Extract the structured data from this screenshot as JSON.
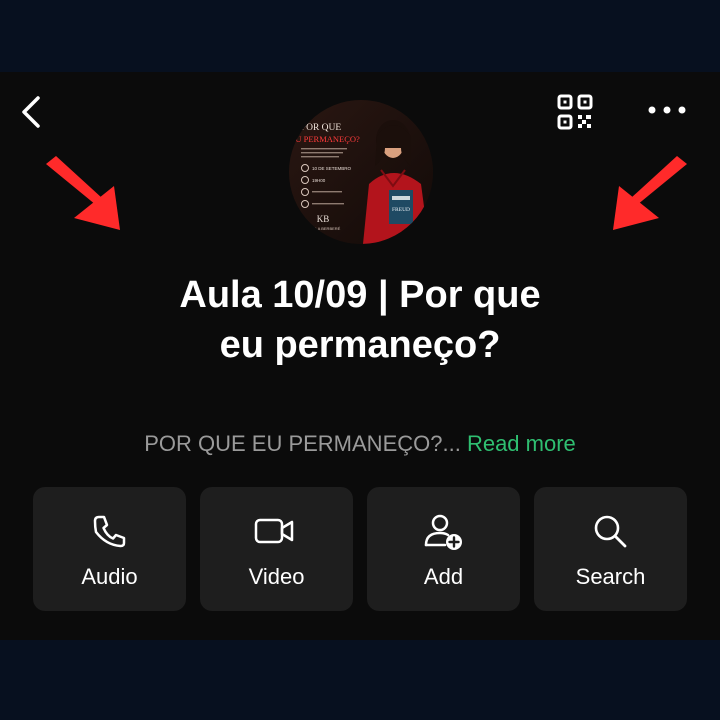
{
  "header": {
    "back_icon": "chevron-left-icon",
    "qr_icon": "qr-code-icon",
    "more_icon": "more-horizontal-icon"
  },
  "avatar": {
    "line1": "POR QUE",
    "line2": "EU PERMANEÇO?",
    "date": "10 DE SETEMBRO",
    "time": "19H00",
    "monogram": "KB",
    "author": "KAMILA BERBERÉ",
    "book_title": "FREUD"
  },
  "annotations": {
    "arrow_color": "#ff2a2a"
  },
  "group": {
    "title_line1": "Aula 10/09 | Por que",
    "title_line2": "eu permaneço?",
    "description": "POR QUE EU PERMANEÇO?...",
    "read_more": "Read more"
  },
  "actions": [
    {
      "label": "Audio",
      "icon": "phone-icon"
    },
    {
      "label": "Video",
      "icon": "video-camera-icon"
    },
    {
      "label": "Add",
      "icon": "add-user-icon"
    },
    {
      "label": "Search",
      "icon": "search-icon"
    }
  ],
  "colors": {
    "background": "#0b0b0b",
    "card": "#1e1e1e",
    "accent_link": "#2fbf71",
    "muted_text": "#9a9a9a"
  }
}
